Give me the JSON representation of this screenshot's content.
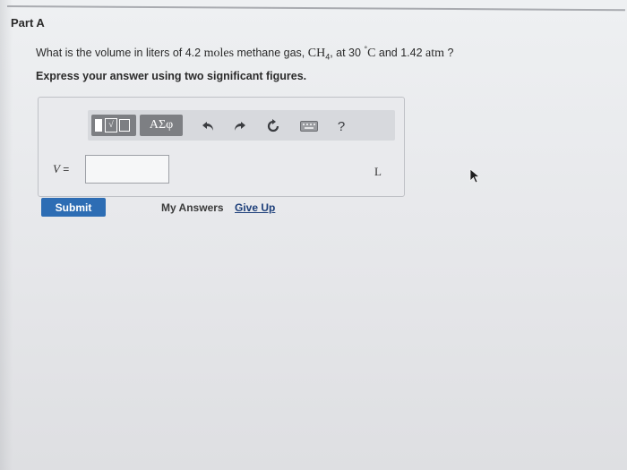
{
  "part": {
    "title": "Part A"
  },
  "question": {
    "prefix": "What is the volume in liters of 4.2 ",
    "moles": "moles",
    "mid": " methane gas, ",
    "formula_base": "CH",
    "formula_sub": "4",
    "after_formula": ", at 30 ",
    "degree": "°",
    "celsius": "C",
    "and": " and 1.42 ",
    "atm": "atm",
    "suffix": " ?"
  },
  "instruction": "Express your answer using two significant figures.",
  "toolbar": {
    "templates_icon": "templates-icon",
    "greek_label": "ΑΣφ",
    "undo_icon": "undo-icon",
    "redo_icon": "redo-icon",
    "reset_icon": "reset-icon",
    "keyboard_icon": "keyboard-icon",
    "help_label": "?"
  },
  "answer": {
    "variable": "V",
    "equals": " =",
    "value": "",
    "unit": "L"
  },
  "actions": {
    "submit_label": "Submit",
    "my_answers_label": "My Answers",
    "give_up_label": "Give Up"
  },
  "colors": {
    "submit_bg": "#2d6db4",
    "toolbar_dark": "#7d7f83",
    "link": "#1d3f7a"
  }
}
